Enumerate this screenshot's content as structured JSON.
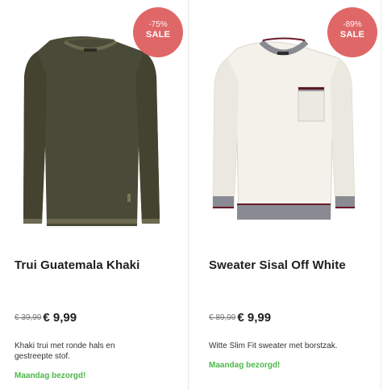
{
  "products": [
    {
      "badge_percent": "-75%",
      "badge_label": "SALE",
      "title": "Trui Guatemala Khaki",
      "old_price": "€ 39,99",
      "new_price": "€ 9,99",
      "description": "Khaki trui met ronde hals en gestreepte stof.",
      "delivery": "Maandag bezorgd!",
      "image_icon": "khaki-sweater-image"
    },
    {
      "badge_percent": "-89%",
      "badge_label": "SALE",
      "title": "Sweater Sisal Off White",
      "old_price": "€ 89,99",
      "new_price": "€ 9,99",
      "description": "Witte Slim Fit sweater met borstzak.",
      "delivery": "Maandag bezorgd!",
      "image_icon": "off-white-sweater-image"
    }
  ],
  "colors": {
    "badge": "#e06767",
    "delivery": "#4cb848",
    "khaki": "#4a4a38",
    "offwhite": "#f3f1ea"
  }
}
